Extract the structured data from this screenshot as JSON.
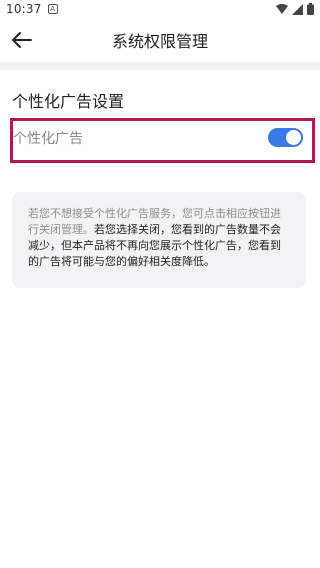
{
  "status_bar": {
    "time": "10:37",
    "notification_icon_letter": "A"
  },
  "header": {
    "title": "系统权限管理"
  },
  "section": {
    "title": "个性化广告设置"
  },
  "setting": {
    "label": "个性化广告",
    "enabled": true
  },
  "info": {
    "muted_text": "若您不想接受个性化广告服务，您可点击相应按钮进行关闭管理。",
    "strong_text": "若您选择关闭，您看到的广告数量不会减少，但本产品将不再向您展示个性化广告，您看到的广告将可能与您的偏好相关度降低。"
  },
  "colors": {
    "toggle_on": "#3a79e6",
    "highlight_border": "#b01a52",
    "card_bg": "#f3f3f5"
  }
}
